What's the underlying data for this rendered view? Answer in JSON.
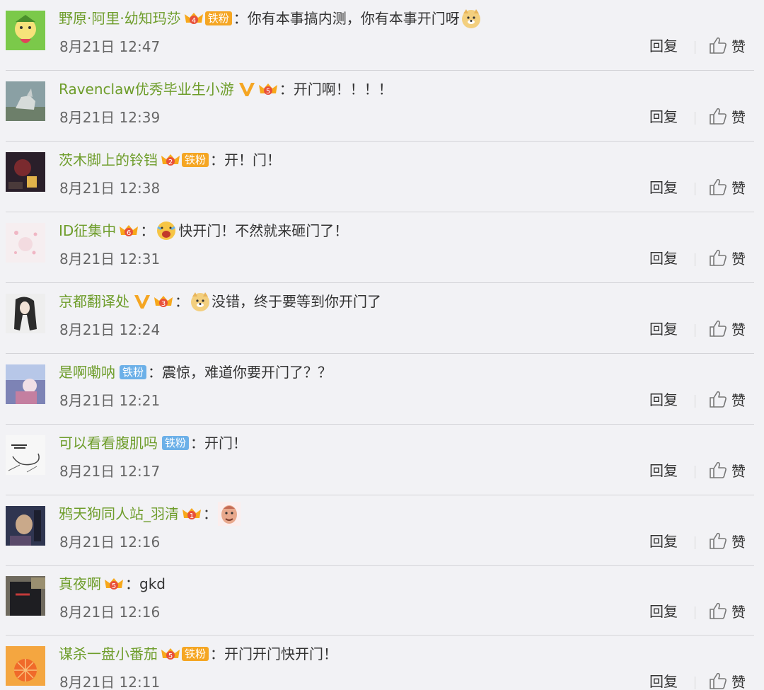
{
  "actions": {
    "reply_label": "回复",
    "like_label": "赞"
  },
  "colors": {
    "username": "#6e9d2b",
    "tiefen_orange": "#f5a623",
    "tiefen_blue": "#6cb0e8",
    "vip_v": "#f5a623"
  },
  "comments": [
    {
      "username": "野原·阿里·幼知玛莎",
      "crown_level": "4",
      "tiefen": "铁粉",
      "text": "你有本事搞内测，你有本事开门呀",
      "time": "8月21日 12:47"
    },
    {
      "username": "Ravenclaw优秀毕业生小游",
      "crown_level": "5",
      "text": "开门啊！！！！",
      "time": "8月21日 12:39"
    },
    {
      "username": "茨木脚上的铃铛",
      "crown_level": "2",
      "tiefen": "铁粉",
      "text": "开！门！",
      "time": "8月21日 12:38"
    },
    {
      "username": "ID征集中",
      "crown_level": "6",
      "text": "快开门！不然就来砸门了！",
      "time": "8月21日 12:31"
    },
    {
      "username": "京都翻译处",
      "crown_level": "3",
      "text": "没错，终于要等到你开门了",
      "time": "8月21日 12:24"
    },
    {
      "username": "是啊嘞呐",
      "tiefen": "铁粉",
      "text": "震惊，难道你要开门了？？",
      "time": "8月21日 12:21"
    },
    {
      "username": "可以看看腹肌吗",
      "tiefen": "铁粉",
      "text": "开门！",
      "time": "8月21日 12:17"
    },
    {
      "username": "鸦天狗同人站_羽清",
      "crown_level": "1",
      "text": "",
      "time": "8月21日 12:16"
    },
    {
      "username": "真夜啊",
      "crown_level": "5",
      "text": "gkd",
      "time": "8月21日 12:16"
    },
    {
      "username": "谋杀一盘小番茄",
      "crown_level": "5",
      "tiefen": "铁粉",
      "text": "开门开门快开门！",
      "time": "8月21日 12:11"
    }
  ]
}
